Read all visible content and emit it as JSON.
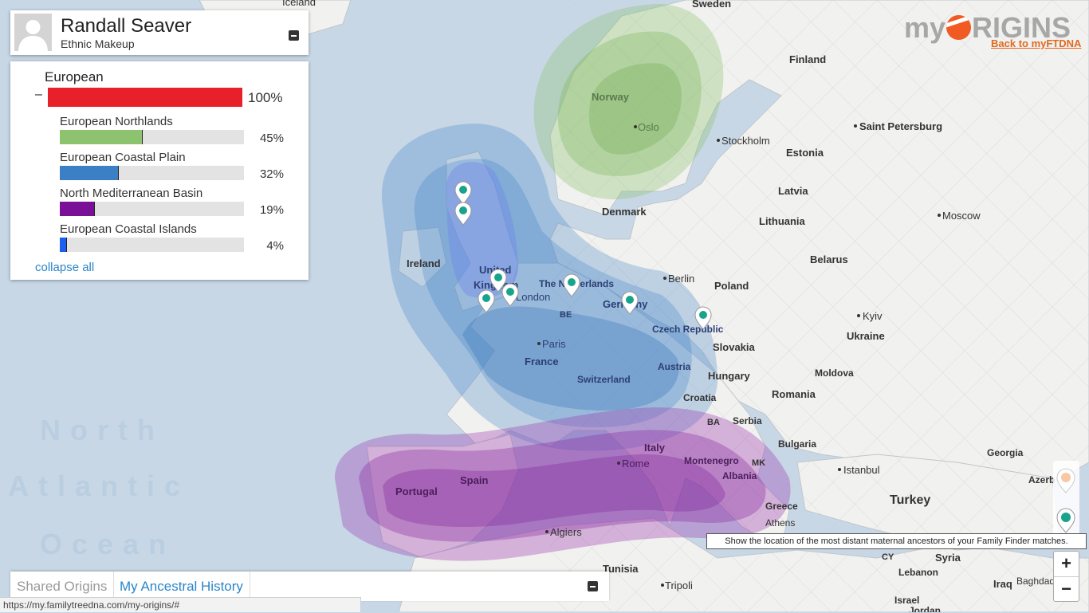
{
  "profile": {
    "name": "Randall Seaver",
    "subtitle": "Ethnic Makeup"
  },
  "ethnic": {
    "category": "European",
    "toggle": "–",
    "category_percent": "100%",
    "category_color": "#e8202a",
    "regions": [
      {
        "label": "European Northlands",
        "percent": "45%",
        "value": 0.45,
        "color": "#8dc26f"
      },
      {
        "label": "European Coastal Plain",
        "percent": "32%",
        "value": 0.32,
        "color": "#3b7fc4"
      },
      {
        "label": "North Mediterranean Basin",
        "percent": "19%",
        "value": 0.19,
        "color": "#7a0f98"
      },
      {
        "label": "European Coastal Islands",
        "percent": "4%",
        "value": 0.04,
        "color": "#1a5ff0"
      }
    ],
    "collapse_all": "collapse all"
  },
  "tabs": {
    "shared": "Shared Origins",
    "history": "My Ancestral History"
  },
  "status_url": "https://my.familytreedna.com/my-origins/#",
  "logo": {
    "prefix": "my",
    "suffix": "RIGINS"
  },
  "back_link": "Back to myFTDNA",
  "tooltip": "Show the location of the most distant maternal ancestors of your Family Finder matches.",
  "zoom": {
    "in": "+",
    "out": "−"
  },
  "map_labels": {
    "iceland": "Iceland",
    "sweden": "Sweden",
    "finland": "Finland",
    "norway": "Norway",
    "oslo": "Oslo",
    "stockholm": "Stockholm",
    "saint_petersburg": "Saint Petersburg",
    "estonia": "Estonia",
    "latvia": "Latvia",
    "denmark": "Denmark",
    "lithuania": "Lithuania",
    "moscow": "Moscow",
    "ireland": "Ireland",
    "united_kingdom_1": "United",
    "united_kingdom_2": "Kingdom",
    "london": "London",
    "netherlands": "The Netherlands",
    "berlin": "Berlin",
    "poland": "Poland",
    "belarus": "Belarus",
    "germany": "Germany",
    "be": "BE",
    "kyiv": "Kyiv",
    "czech": "Czech Republic",
    "ukraine": "Ukraine",
    "paris": "Paris",
    "slovakia": "Slovakia",
    "france": "France",
    "austria": "Austria",
    "switzerland": "Switzerland",
    "hungary": "Hungary",
    "moldova": "Moldova",
    "romania": "Romania",
    "croatia": "Croatia",
    "ba": "BA",
    "serbia": "Serbia",
    "italy": "Italy",
    "bulgaria": "Bulgaria",
    "montenegro": "Montenegro",
    "mk": "MK",
    "rome": "Rome",
    "georgia": "Georgia",
    "istanbul": "Istanbul",
    "spain": "Spain",
    "portugal": "Portugal",
    "albania": "Albania",
    "azerb": "Azerb",
    "turkey": "Turkey",
    "greece": "Greece",
    "athens": "Athens",
    "algiers": "Algiers",
    "cy": "CY",
    "syria": "Syria",
    "tunisia": "Tunisia",
    "lebanon": "Lebanon",
    "iraq": "Iraq",
    "tripoli": "Tripoli",
    "israel": "Israel",
    "baghdad": "Baghdad",
    "jordan": "Jordan",
    "north": "North",
    "atlantic": "Atlantic",
    "ocean": "Ocean"
  },
  "colors": {
    "sea": "#c7d7e6",
    "land": "#f1f1ef",
    "accent": "#f15a22",
    "link": "#2a86c8"
  }
}
